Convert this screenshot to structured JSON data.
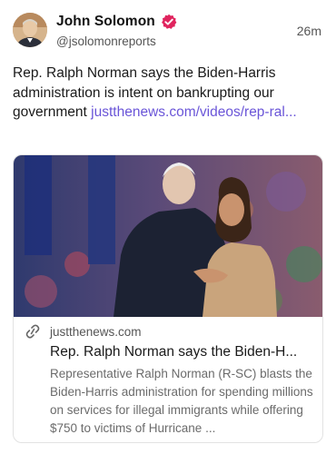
{
  "post": {
    "author": {
      "display_name": "John Solomon",
      "handle": "@jsolomonreports",
      "verified_icon": "verified-badge-icon",
      "verified_color": "#e0245e"
    },
    "timestamp": "26m",
    "text": "Rep. Ralph Norman says the Biden-Harris administration is intent on bankrupting our government ",
    "link_text": "justthenews.com/videos/rep-ral...",
    "link_color": "#6a55d8"
  },
  "card": {
    "image_alt": "Photo of two people embracing on a stage",
    "domain_icon": "link-icon",
    "domain": "justthenews.com",
    "title": "Rep. Ralph Norman says the Biden-H...",
    "description": "Representative Ralph Norman (R-SC) blasts the Biden-Harris administration for spending millions on services for illegal immigrants while offering $750 to victims of Hurricane ..."
  }
}
